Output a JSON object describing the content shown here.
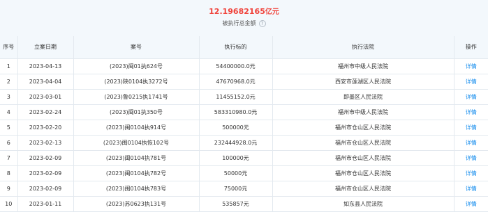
{
  "summary": {
    "amount": "12.19682165",
    "unit": "亿元",
    "label": "被执行总金额",
    "help_icon": "question-circle-icon"
  },
  "table": {
    "headers": [
      "序号",
      "立案日期",
      "案号",
      "执行标的",
      "执行法院",
      "操作"
    ],
    "rows": [
      {
        "no": "1",
        "date": "2023-04-13",
        "case": "(2023)闽01执624号",
        "amount": "54400000.0元",
        "court": "福州市中级人民法院",
        "action": "详情"
      },
      {
        "no": "2",
        "date": "2023-04-04",
        "case": "(2023)陕0104执3272号",
        "amount": "47670968.0元",
        "court": "西安市莲湖区人民法院",
        "action": "详情"
      },
      {
        "no": "3",
        "date": "2023-03-01",
        "case": "(2023)鲁0215执1741号",
        "amount": "11455152.0元",
        "court": "即墨区人民法院",
        "action": "详情"
      },
      {
        "no": "4",
        "date": "2023-02-24",
        "case": "(2023)闽01执350号",
        "amount": "583310980.0元",
        "court": "福州市中级人民法院",
        "action": "详情"
      },
      {
        "no": "5",
        "date": "2023-02-20",
        "case": "(2023)闽0104执914号",
        "amount": "500000元",
        "court": "福州市仓山区人民法院",
        "action": "详情"
      },
      {
        "no": "6",
        "date": "2023-02-13",
        "case": "(2023)闽0104执恢102号",
        "amount": "232444928.0元",
        "court": "福州市仓山区人民法院",
        "action": "详情"
      },
      {
        "no": "7",
        "date": "2023-02-09",
        "case": "(2023)闽0104执781号",
        "amount": "100000元",
        "court": "福州市仓山区人民法院",
        "action": "详情"
      },
      {
        "no": "8",
        "date": "2023-02-09",
        "case": "(2023)闽0104执782号",
        "amount": "50000元",
        "court": "福州市仓山区人民法院",
        "action": "详情"
      },
      {
        "no": "9",
        "date": "2023-02-09",
        "case": "(2023)闽0104执783号",
        "amount": "75000元",
        "court": "福州市仓山区人民法院",
        "action": "详情"
      },
      {
        "no": "10",
        "date": "2023-01-11",
        "case": "(2023)苏0623执131号",
        "amount": "535857元",
        "court": "如东县人民法院",
        "action": "详情"
      }
    ]
  },
  "colors": {
    "amount": "#f0443c",
    "link": "#128bed",
    "header_bg": "#f3f8fc",
    "border": "#e3e9ef"
  }
}
